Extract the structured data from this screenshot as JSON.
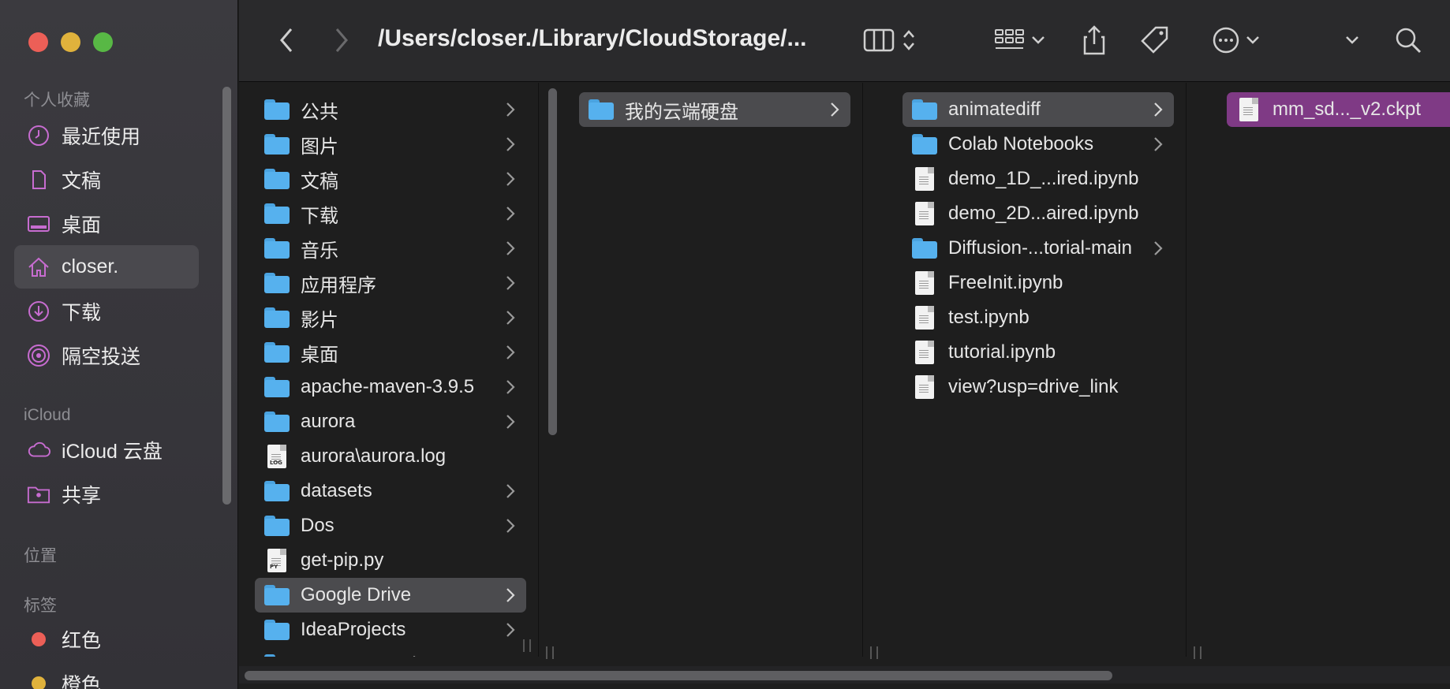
{
  "window": {
    "title": "/Users/closer./Library/CloudStorage/..."
  },
  "sidebar": {
    "favorites_header": "个人收藏",
    "favorites": [
      {
        "label": "最近使用",
        "icon": "clock-icon"
      },
      {
        "label": "文稿",
        "icon": "document-icon"
      },
      {
        "label": "桌面",
        "icon": "desktop-icon"
      },
      {
        "label": "closer.",
        "icon": "home-icon",
        "active": true
      },
      {
        "label": "下载",
        "icon": "download-icon"
      },
      {
        "label": "隔空投送",
        "icon": "airdrop-icon"
      }
    ],
    "icloud_header": "iCloud",
    "icloud": [
      {
        "label": "iCloud 云盘",
        "icon": "cloud-icon"
      },
      {
        "label": "共享",
        "icon": "shared-folder-icon"
      }
    ],
    "locations_header": "位置",
    "tags_header": "标签",
    "tags": [
      {
        "label": "红色",
        "color": "#ec5f57"
      },
      {
        "label": "橙色",
        "color": "#e0b23c"
      }
    ]
  },
  "columns": {
    "home": [
      {
        "name": "公共",
        "kind": "folder"
      },
      {
        "name": "图片",
        "kind": "folder"
      },
      {
        "name": "文稿",
        "kind": "folder"
      },
      {
        "name": "下载",
        "kind": "folder"
      },
      {
        "name": "音乐",
        "kind": "folder"
      },
      {
        "name": "应用程序",
        "kind": "folder"
      },
      {
        "name": "影片",
        "kind": "folder"
      },
      {
        "name": "桌面",
        "kind": "folder"
      },
      {
        "name": "apache-maven-3.9.5",
        "kind": "folder"
      },
      {
        "name": "aurora",
        "kind": "folder"
      },
      {
        "name": "aurora\\aurora.log",
        "kind": "log"
      },
      {
        "name": "datasets",
        "kind": "folder"
      },
      {
        "name": "Dos",
        "kind": "folder"
      },
      {
        "name": "get-pip.py",
        "kind": "py"
      },
      {
        "name": "Google Drive",
        "kind": "folder",
        "selected": true
      },
      {
        "name": "IdeaProjects",
        "kind": "folder"
      },
      {
        "name": "mavenRepository",
        "kind": "folder"
      }
    ],
    "drive": [
      {
        "name": "我的云端硬盘",
        "kind": "folder",
        "selected": true
      }
    ],
    "mydrive": [
      {
        "name": "animatediff",
        "kind": "folder",
        "selected": true
      },
      {
        "name": "Colab Notebooks",
        "kind": "folder"
      },
      {
        "name": "demo_1D_...ired.ipynb",
        "kind": "file"
      },
      {
        "name": "demo_2D...aired.ipynb",
        "kind": "file"
      },
      {
        "name": "Diffusion-...torial-main",
        "kind": "folder"
      },
      {
        "name": "FreeInit.ipynb",
        "kind": "file"
      },
      {
        "name": "test.ipynb",
        "kind": "file"
      },
      {
        "name": "tutorial.ipynb",
        "kind": "file"
      },
      {
        "name": "view?usp=drive_link",
        "kind": "file"
      }
    ],
    "animatediff": [
      {
        "name": "mm_sd..._v2.ckpt",
        "kind": "file",
        "selected": true
      }
    ]
  },
  "colors": {
    "selection": "#7f3a85",
    "folder": "#56b1ee"
  }
}
